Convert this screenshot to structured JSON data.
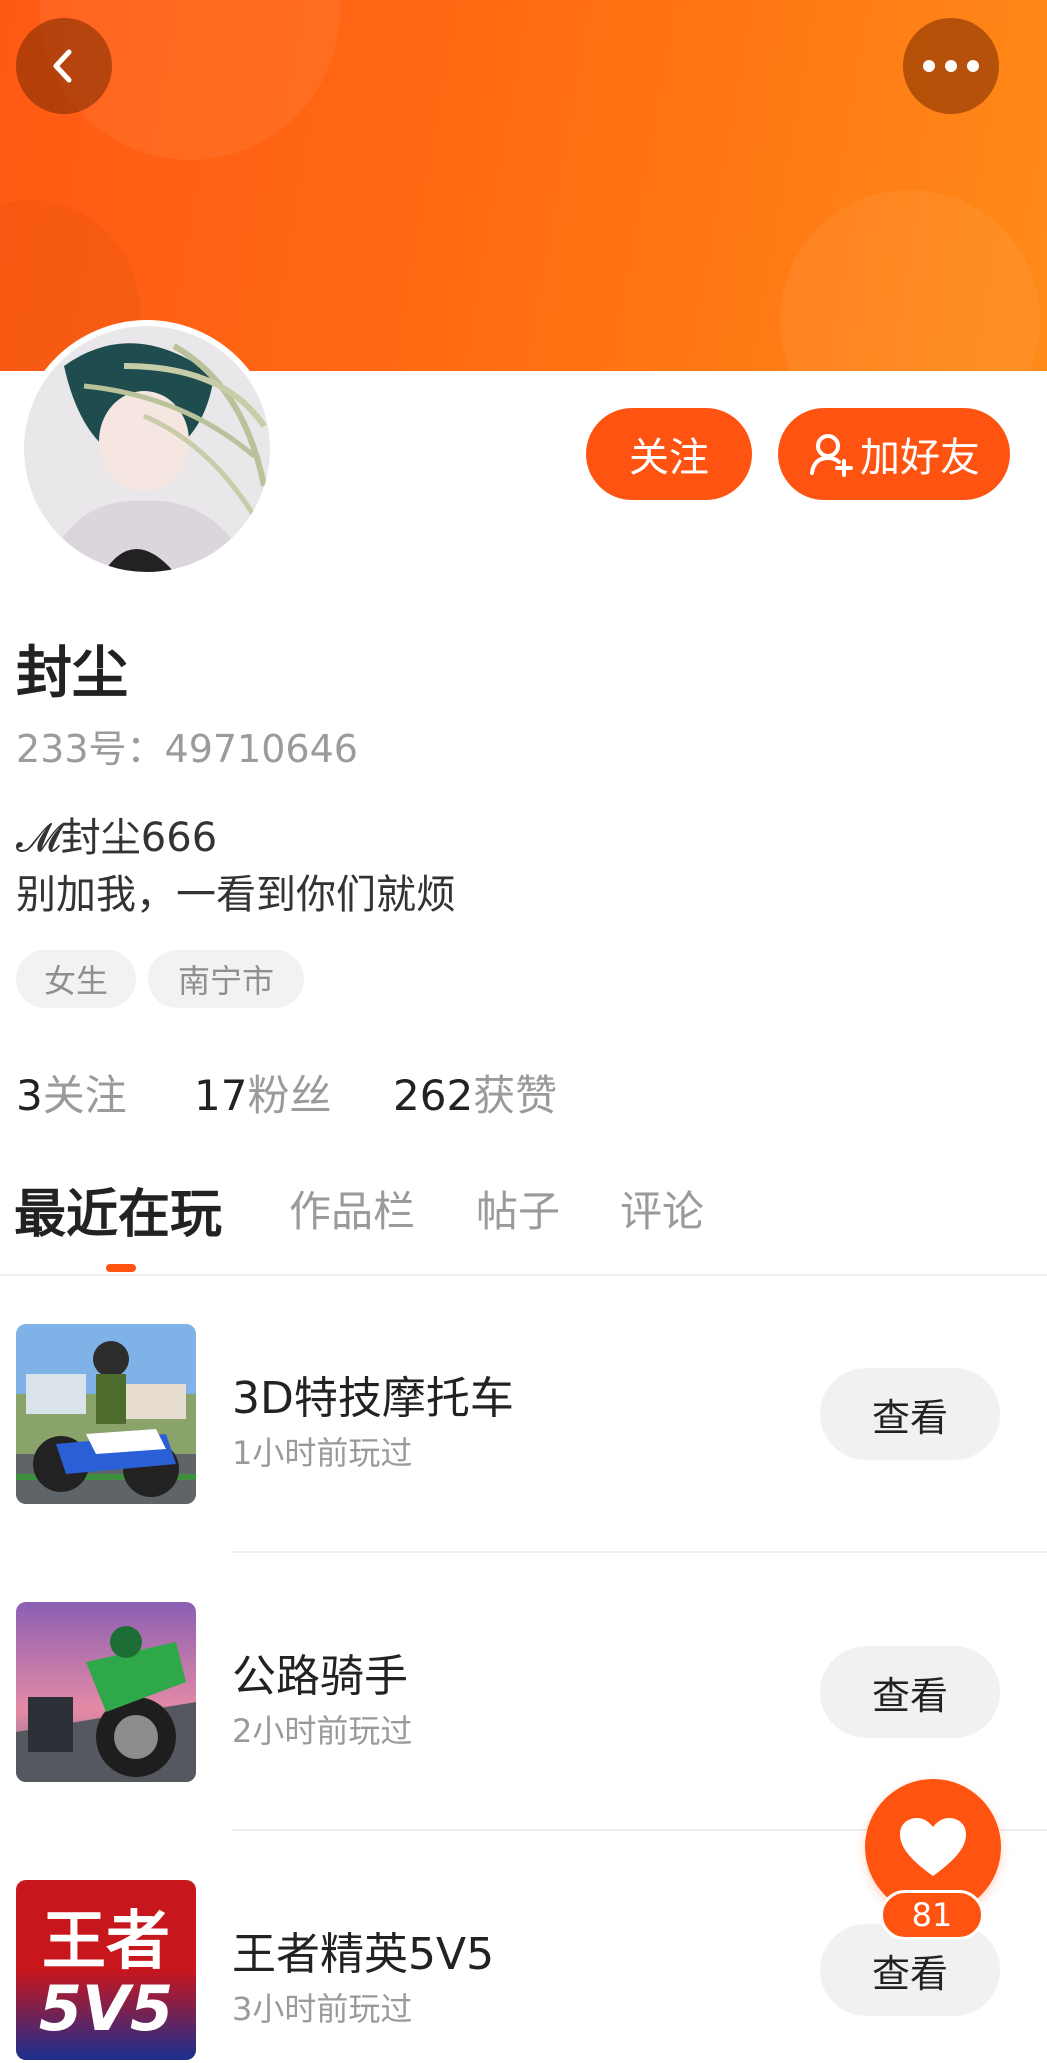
{
  "header": {
    "back_icon": "chevron-left-icon",
    "more_icon": "more-dots-icon"
  },
  "profile": {
    "follow_label": "关注",
    "add_friend_label": "加好友",
    "name": "封尘",
    "uid_text": "233号：49710646",
    "bio_line1": "𝓜封尘666",
    "bio_line2": "别加我，一看到你们就烦",
    "tags": [
      "女生",
      "南宁市"
    ],
    "stats": [
      {
        "value": "3",
        "label": "关注"
      },
      {
        "value": "17",
        "label": "粉丝"
      },
      {
        "value": "262",
        "label": "获赞"
      }
    ]
  },
  "tabs": [
    "最近在玩",
    "作品栏",
    "帖子",
    "评论"
  ],
  "active_tab": "最近在玩",
  "games": [
    {
      "title": "3D特技摩托车",
      "played": "1小时前玩过",
      "button": "查看"
    },
    {
      "title": "公路骑手",
      "played": "2小时前玩过",
      "button": "查看"
    },
    {
      "title": "王者精英5V5",
      "played": "3小时前玩过",
      "button": "查看",
      "thumb_text_top": "王者",
      "thumb_text_bottom": "5V5"
    }
  ],
  "fab": {
    "icon": "heart-icon",
    "count": "81"
  },
  "colors": {
    "accent": "#ff5311",
    "banner": "#ff6a12"
  }
}
